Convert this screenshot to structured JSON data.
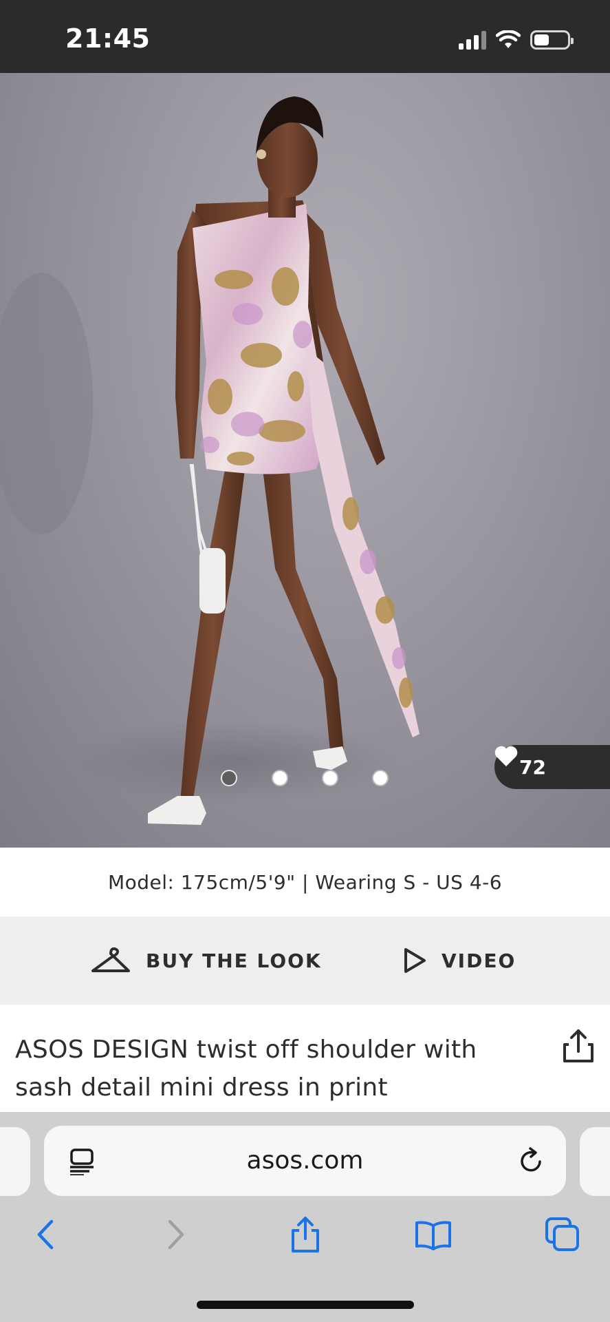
{
  "status_bar": {
    "time": "21:45",
    "battery_level": 0.46
  },
  "gallery": {
    "dots_total": 4,
    "active_index": 0,
    "likes_count": "72"
  },
  "model_info": "Model: 175cm/5'9\" | Wearing S - US 4-6",
  "actions": {
    "buy_label": "BUY THE LOOK",
    "video_label": "VIDEO"
  },
  "product": {
    "title": "ASOS DESIGN twist off shoulder with sash detail mini dress in print"
  },
  "browser": {
    "url": "asos.com",
    "accent_color": "#1a73e8",
    "toolbar_icons": [
      "back-icon",
      "forward-icon",
      "share-icon",
      "bookmarks-icon",
      "tabs-icon"
    ]
  }
}
